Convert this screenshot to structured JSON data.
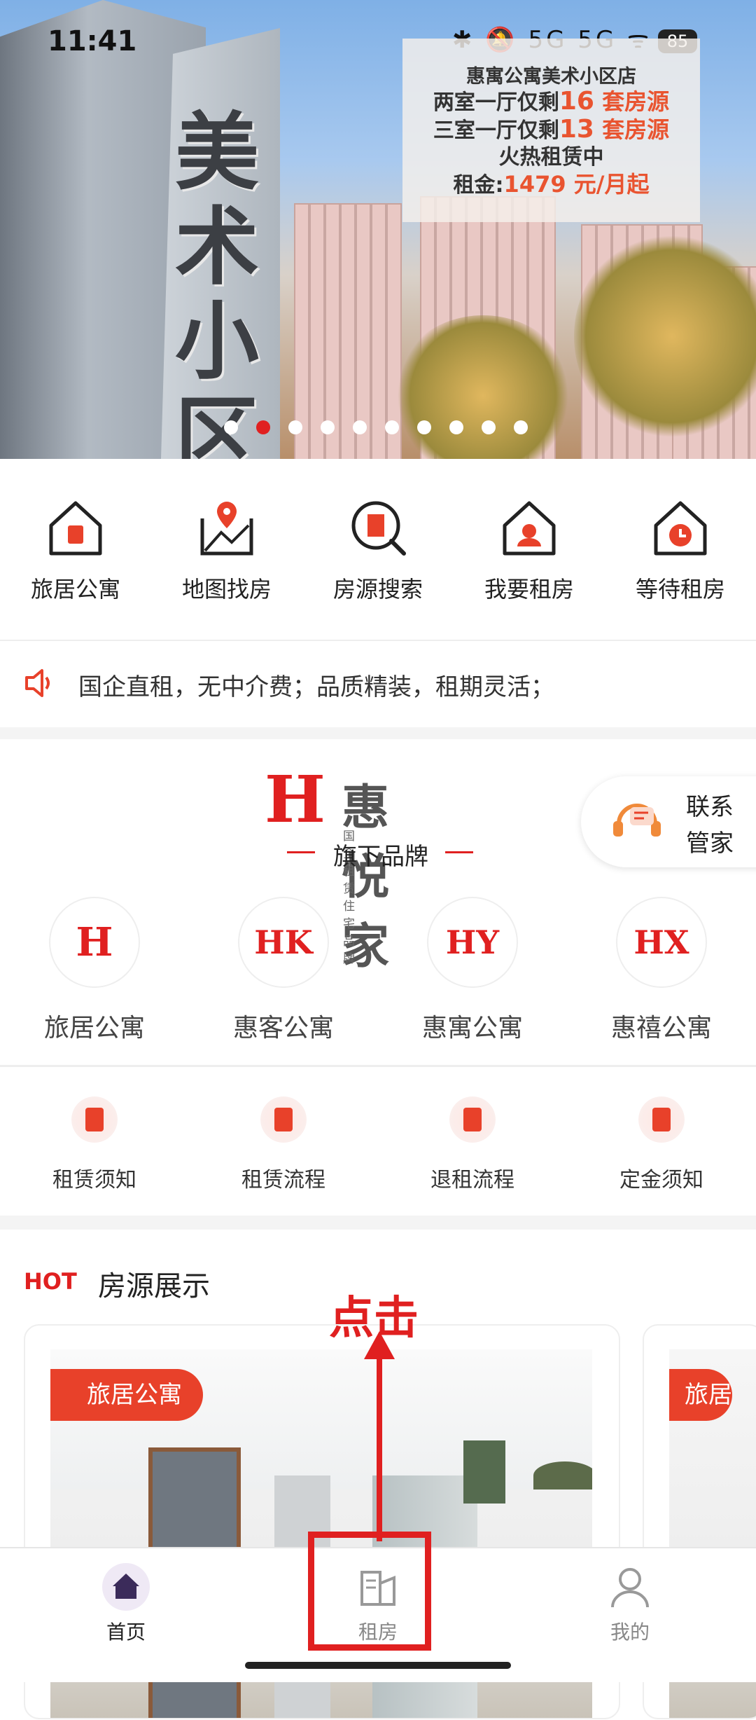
{
  "status_bar": {
    "time": "11:41",
    "icons": "✱ 🔕 5G 5G ᯤ",
    "battery": "85"
  },
  "banner": {
    "monument_text": "美术小区",
    "promo": {
      "line1": "惠寓公寓美术小区店",
      "line2_prefix": "两室一厅仅剩",
      "line2_count": "16",
      "line2_suffix": " 套房源",
      "line3_prefix": "三室一厅仅剩",
      "line3_count": "13",
      "line3_suffix": " 套房源",
      "line4": "火热租赁中",
      "line5_prefix": "租金:",
      "line5_value": "1479 元/月起"
    },
    "carousel": {
      "count": 10,
      "active": 1
    }
  },
  "quick_nav": [
    {
      "label": "旅居公寓",
      "icon": "apartment-house-icon"
    },
    {
      "label": "地图找房",
      "icon": "map-pin-icon"
    },
    {
      "label": "房源搜索",
      "icon": "search-building-icon"
    },
    {
      "label": "我要租房",
      "icon": "rent-house-icon"
    },
    {
      "label": "等待租房",
      "icon": "waiting-clock-house-icon"
    }
  ],
  "notice": {
    "text": "国企直租，无中介费；品质精装，租期灵活；",
    "icon": "speaker-icon"
  },
  "brand": {
    "logo_mark": "H",
    "name": "惠悦家",
    "tagline": "国企租赁住宅品牌",
    "subtitle": "旗下品牌",
    "contact_label": "联系 管家",
    "items": [
      {
        "mark": "H",
        "label": "旅居公寓"
      },
      {
        "mark": "HK",
        "label": "惠客公寓"
      },
      {
        "mark": "HY",
        "label": "惠寓公寓"
      },
      {
        "mark": "HX",
        "label": "惠禧公寓"
      }
    ],
    "rules": [
      {
        "label": "租赁须知"
      },
      {
        "label": "租赁流程"
      },
      {
        "label": "退租流程"
      },
      {
        "label": "定金须知"
      }
    ]
  },
  "hot": {
    "tag": "HOT",
    "title": "房源展示",
    "card_badge": "旅居公寓",
    "card2_badge": "旅居"
  },
  "annotation": {
    "text": "点击"
  },
  "tabbar": [
    {
      "label": "首页",
      "icon": "home-icon",
      "active": true
    },
    {
      "label": "租房",
      "icon": "building-icon",
      "active": false
    },
    {
      "label": "我的",
      "icon": "user-icon",
      "active": false
    }
  ],
  "colors": {
    "accent": "#e02020",
    "icon_red": "#e8412a"
  }
}
